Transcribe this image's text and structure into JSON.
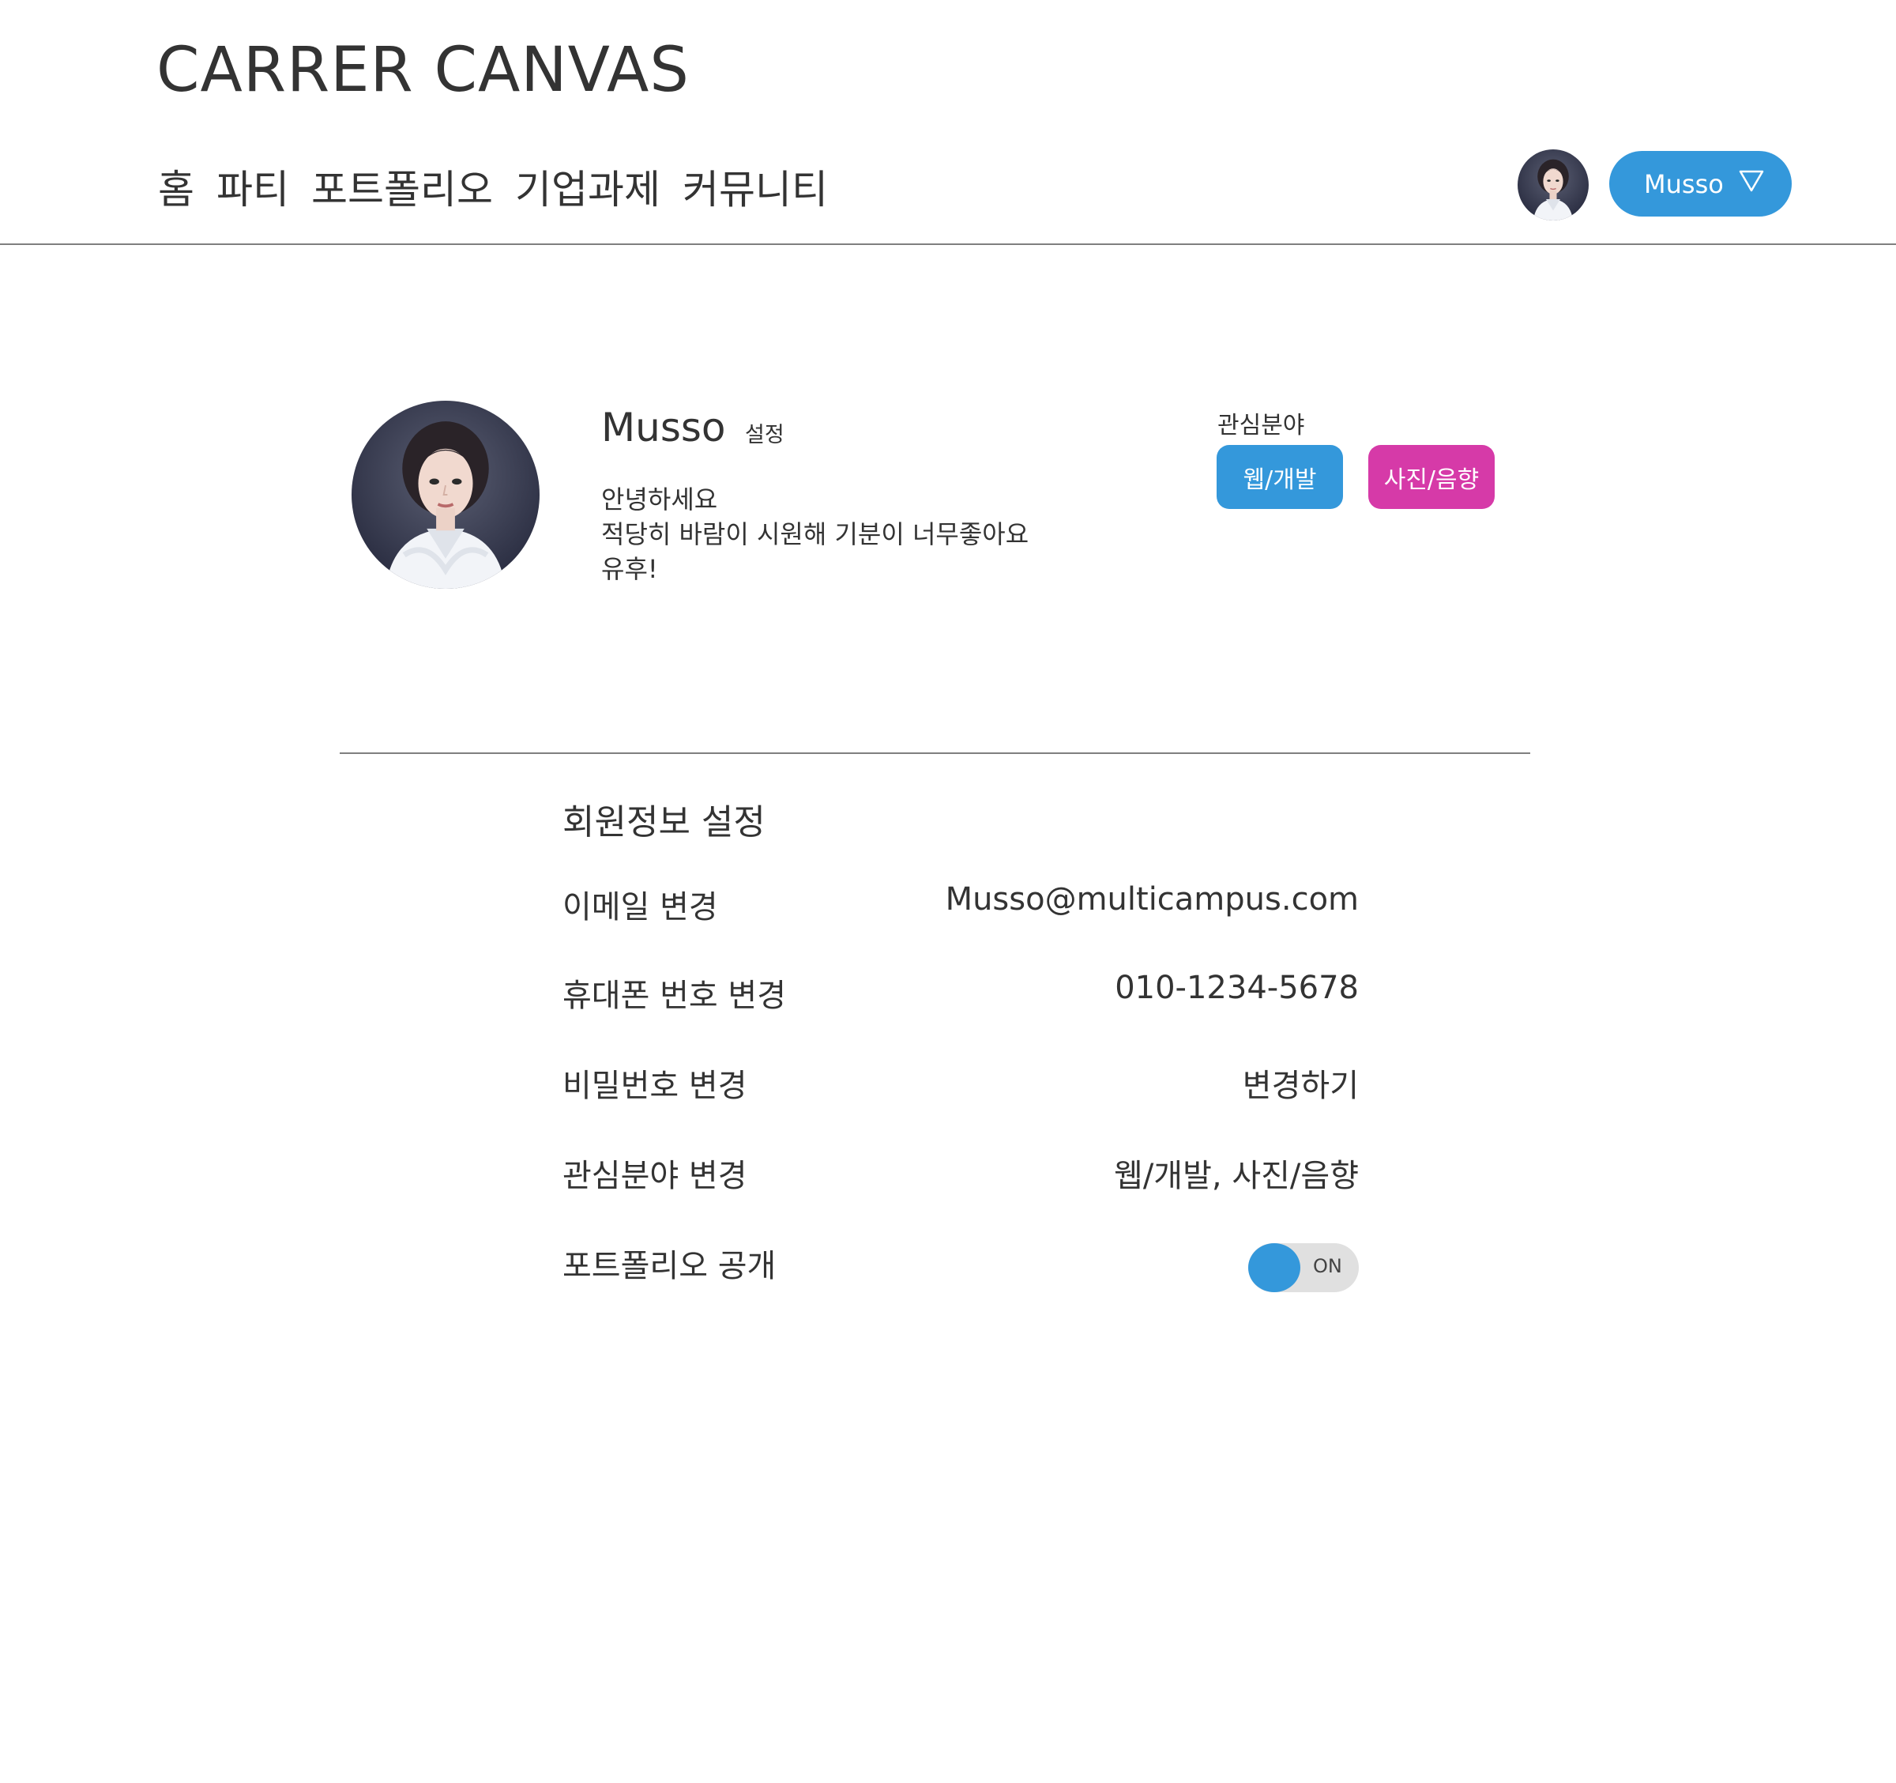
{
  "app": {
    "logo": "CARRER CANVAS"
  },
  "nav": {
    "items": [
      {
        "label": "홈"
      },
      {
        "label": "파티"
      },
      {
        "label": "포트폴리오"
      },
      {
        "label": "기업과제"
      },
      {
        "label": "커뮤니티"
      }
    ]
  },
  "header": {
    "user_button_label": "Musso",
    "dropdown_icon": "triangle-down-outline-icon",
    "avatar_icon": "user-photo-avatar"
  },
  "profile": {
    "name": "Musso",
    "settings_link": "설정",
    "bio_lines": [
      "안녕하세요",
      "적당히 바람이 시원해 기분이 너무좋아요",
      "유후!"
    ],
    "interest_title": "관심분야",
    "interests": [
      {
        "label": "웹/개발",
        "color": "#3498db"
      },
      {
        "label": "사진/음향",
        "color": "#d63aa8"
      }
    ]
  },
  "settings": {
    "title": "회원정보 설정",
    "rows": [
      {
        "label": "이메일 변경",
        "value": "Musso@multicampus.com"
      },
      {
        "label": "휴대폰 번호 변경",
        "value": "010-1234-5678"
      },
      {
        "label": "비밀번호 변경",
        "value": "변경하기"
      },
      {
        "label": "관심분야 변경",
        "value": "웹/개발, 사진/음향"
      },
      {
        "label": "포트폴리오 공개",
        "toggle_label": "ON",
        "toggle_on": true
      }
    ]
  },
  "colors": {
    "accent": "#3498db",
    "pink": "#d63aa8",
    "text": "#333333",
    "divider": "#7f7f7f"
  }
}
